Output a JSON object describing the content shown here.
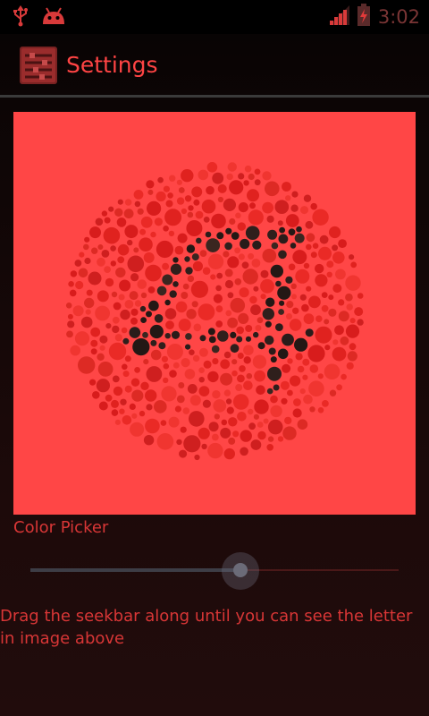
{
  "status_bar": {
    "time": "3:02",
    "left_icons": [
      "usb-icon",
      "android-debug-icon"
    ],
    "right_icons": [
      "signal-icon",
      "battery-charging-icon"
    ]
  },
  "action_bar": {
    "app_icon": "settings-sliders-icon",
    "title": "Settings"
  },
  "color_plate": {
    "background_color": "#ff4646",
    "dot_color": "#e0221f",
    "figure_color": "#2a1c1a",
    "hidden_digit": "4"
  },
  "color_picker": {
    "label": "Color Picker",
    "seekbar_progress": 0.57
  },
  "instructions": "Drag the seekbar along until you can see the letter in image above",
  "colors": {
    "accent": "#ff4444",
    "text": "#d83636",
    "status_bar_bg": "#000000"
  }
}
